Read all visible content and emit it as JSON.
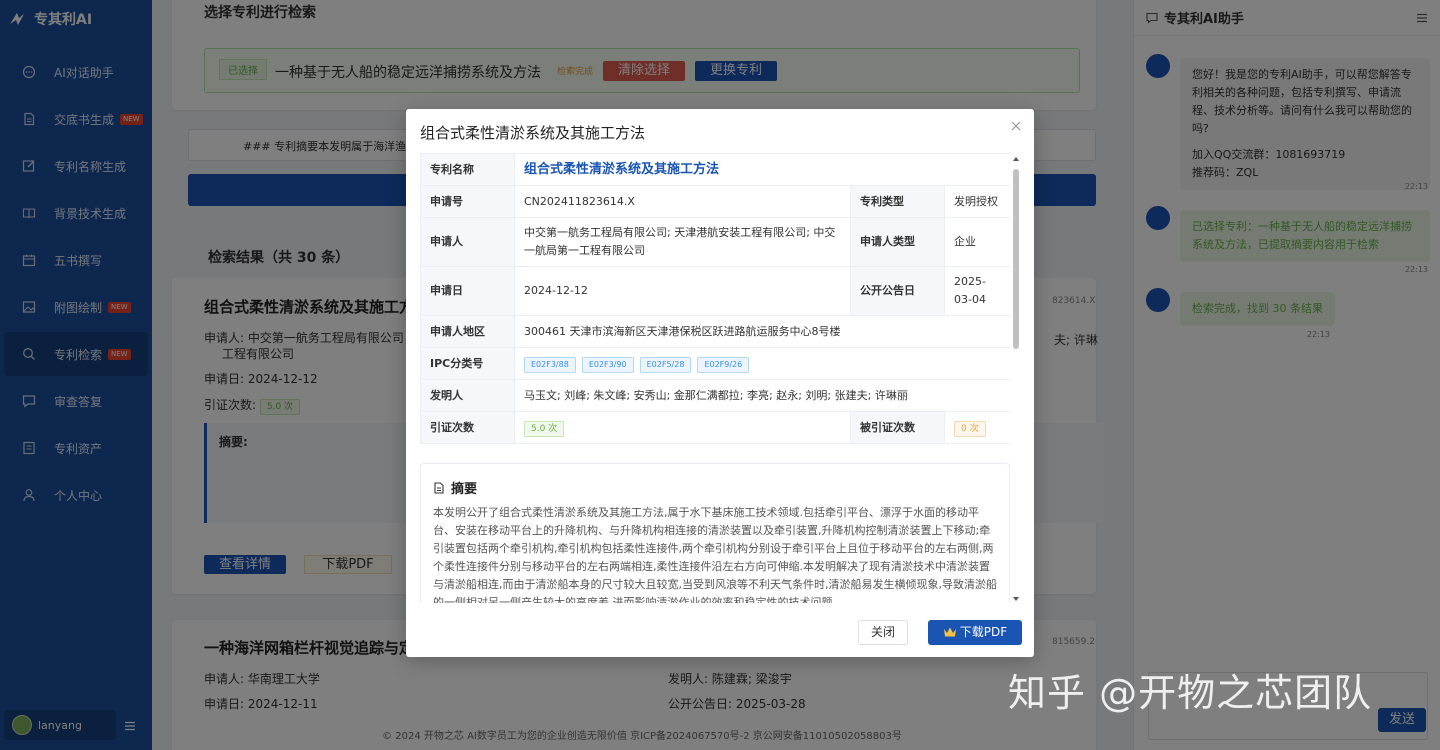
{
  "app": {
    "name": "专其利AI"
  },
  "sidebar": {
    "items": [
      {
        "label": "AI对话助手",
        "new": false,
        "active": false
      },
      {
        "label": "交底书生成",
        "new": true,
        "active": false
      },
      {
        "label": "专利名称生成",
        "new": false,
        "active": false
      },
      {
        "label": "背景技术生成",
        "new": false,
        "active": false
      },
      {
        "label": "五书撰写",
        "new": false,
        "active": false
      },
      {
        "label": "附图绘制",
        "new": true,
        "active": false
      },
      {
        "label": "专利检索",
        "new": true,
        "active": true
      },
      {
        "label": "审查答复",
        "new": false,
        "active": false
      },
      {
        "label": "专利资产",
        "new": false,
        "active": false
      },
      {
        "label": "个人中心",
        "new": false,
        "active": false
      }
    ],
    "new_badge": "NEW",
    "user": "lanyang"
  },
  "main": {
    "select_title": "选择专利进行检索",
    "selected_tag": "已选择",
    "selected_name": "一种基于无人船的稳定远洋捕捞系统及方法",
    "status_tag": "检索完成",
    "clear_button": "清除选择",
    "switch_button": "更换专利",
    "search_text": "### 专利摘要本发明属于海洋渔业",
    "results_title": "检索结果（共 30 条）",
    "result1": {
      "title": "组合式柔性清淤系统及其施工方",
      "applicant_label": "申请人:",
      "applicant": "中交第一航务工程局有限公司",
      "applicant_line2": "工程有限公司",
      "date_label": "申请日:",
      "date": "2024-12-12",
      "cite_label": "引证次数:",
      "cite_value": "5.0 次",
      "abstract_label": "摘要:",
      "detail_button": "查看详情",
      "pdf_button": "下载PDF",
      "right_code": "823614.X",
      "right_name": "夫; 许琳"
    },
    "result2": {
      "title": "一种海洋网箱栏杆视觉追踪与定位",
      "applicant_label": "申请人:",
      "applicant": "华南理工大学",
      "date_label": "申请日:",
      "date": "2024-12-11",
      "inventor_label": "发明人:",
      "inventor": "陈建霖; 梁浚宇",
      "pub_label": "公开公告日:",
      "pub_date": "2025-03-28",
      "right_code": "815659.2"
    },
    "footer": "© 2024 开物之芯 AI数字员工为您的企业创造无限价值 京ICP备2024067570号-2   京公网安备11010502058803号"
  },
  "assistant": {
    "title": "专其利AI助手",
    "messages": [
      {
        "text": "您好！我是您的专利AI助手，可以帮您解答专利相关的各种问题，包括专利撰写、申请流程、技术分析等。请问有什么我可以帮助您的吗?",
        "text2": "加入QQ交流群：1081693719",
        "text3": "推荐码：ZQL",
        "time": "22:13"
      },
      {
        "text": "已选择专利：一种基于无人船的稳定远洋捕捞系统及方法，已提取摘要内容用于检索",
        "time": "22:13"
      },
      {
        "text": "检索完成，找到 30 条结果",
        "time": "22:13"
      }
    ],
    "send_button": "发送"
  },
  "modal": {
    "title": "组合式柔性清淤系统及其施工方法",
    "labels": {
      "name": "专利名称",
      "app_no": "申请号",
      "type": "专利类型",
      "applicant": "申请人",
      "applicant_type": "申请人类型",
      "app_date": "申请日",
      "pub_date": "公开公告日",
      "region": "申请人地区",
      "ipc": "IPC分类号",
      "inventor": "发明人",
      "cite": "引证次数",
      "cited": "被引证次数"
    },
    "values": {
      "name": "组合式柔性清淤系统及其施工方法",
      "app_no": "CN202411823614.X",
      "type": "发明授权",
      "applicant": "中交第一航务工程局有限公司; 天津港航安装工程有限公司; 中交一航局第一工程有限公司",
      "applicant_type": "企业",
      "app_date": "2024-12-12",
      "pub_date": "2025-03-04",
      "region": "300461 天津市滨海新区天津港保税区跃进路航运服务中心8号楼",
      "ipc": [
        "E02F3/88",
        "E02F3/90",
        "E02F5/28",
        "E02F9/26"
      ],
      "inventor": "马玉文; 刘峰; 朱文峰; 安秀山; 金那仁满都拉; 李亮; 赵永; 刘明; 张建夫; 许琳丽",
      "cite": "5.0 次",
      "cited": "0 次"
    },
    "abstract_title": "摘要",
    "abstract": "本发明公开了组合式柔性清淤系统及其施工方法,属于水下基床施工技术领域.包括牵引平台、漂浮于水面的移动平台、安装在移动平台上的升降机构、与升降机构相连接的清淤装置以及牵引装置,升降机构控制清淤装置上下移动;牵引装置包括两个牵引机构,牵引机构包括柔性连接件,两个牵引机构分别设于牵引平台上且位于移动平台的左右两侧,两个柔性连接件分别与移动平台的左右两端相连,柔性连接件沿左右方向可伸缩.本发明解决了现有清淤技术中清淤装置与清淤船相连,而由于清淤船本身的尺寸较大且较宽,当受到风浪等不利天气条件时,清淤船易发生横倾现象,导致清淤船的一侧相对另一侧产生较大的高度差,进而影响清淤作业的效率和稳定性的技术问题。",
    "close_button": "关闭",
    "download_button": "下载PDF"
  },
  "watermark": "知乎 @开物之芯团队"
}
